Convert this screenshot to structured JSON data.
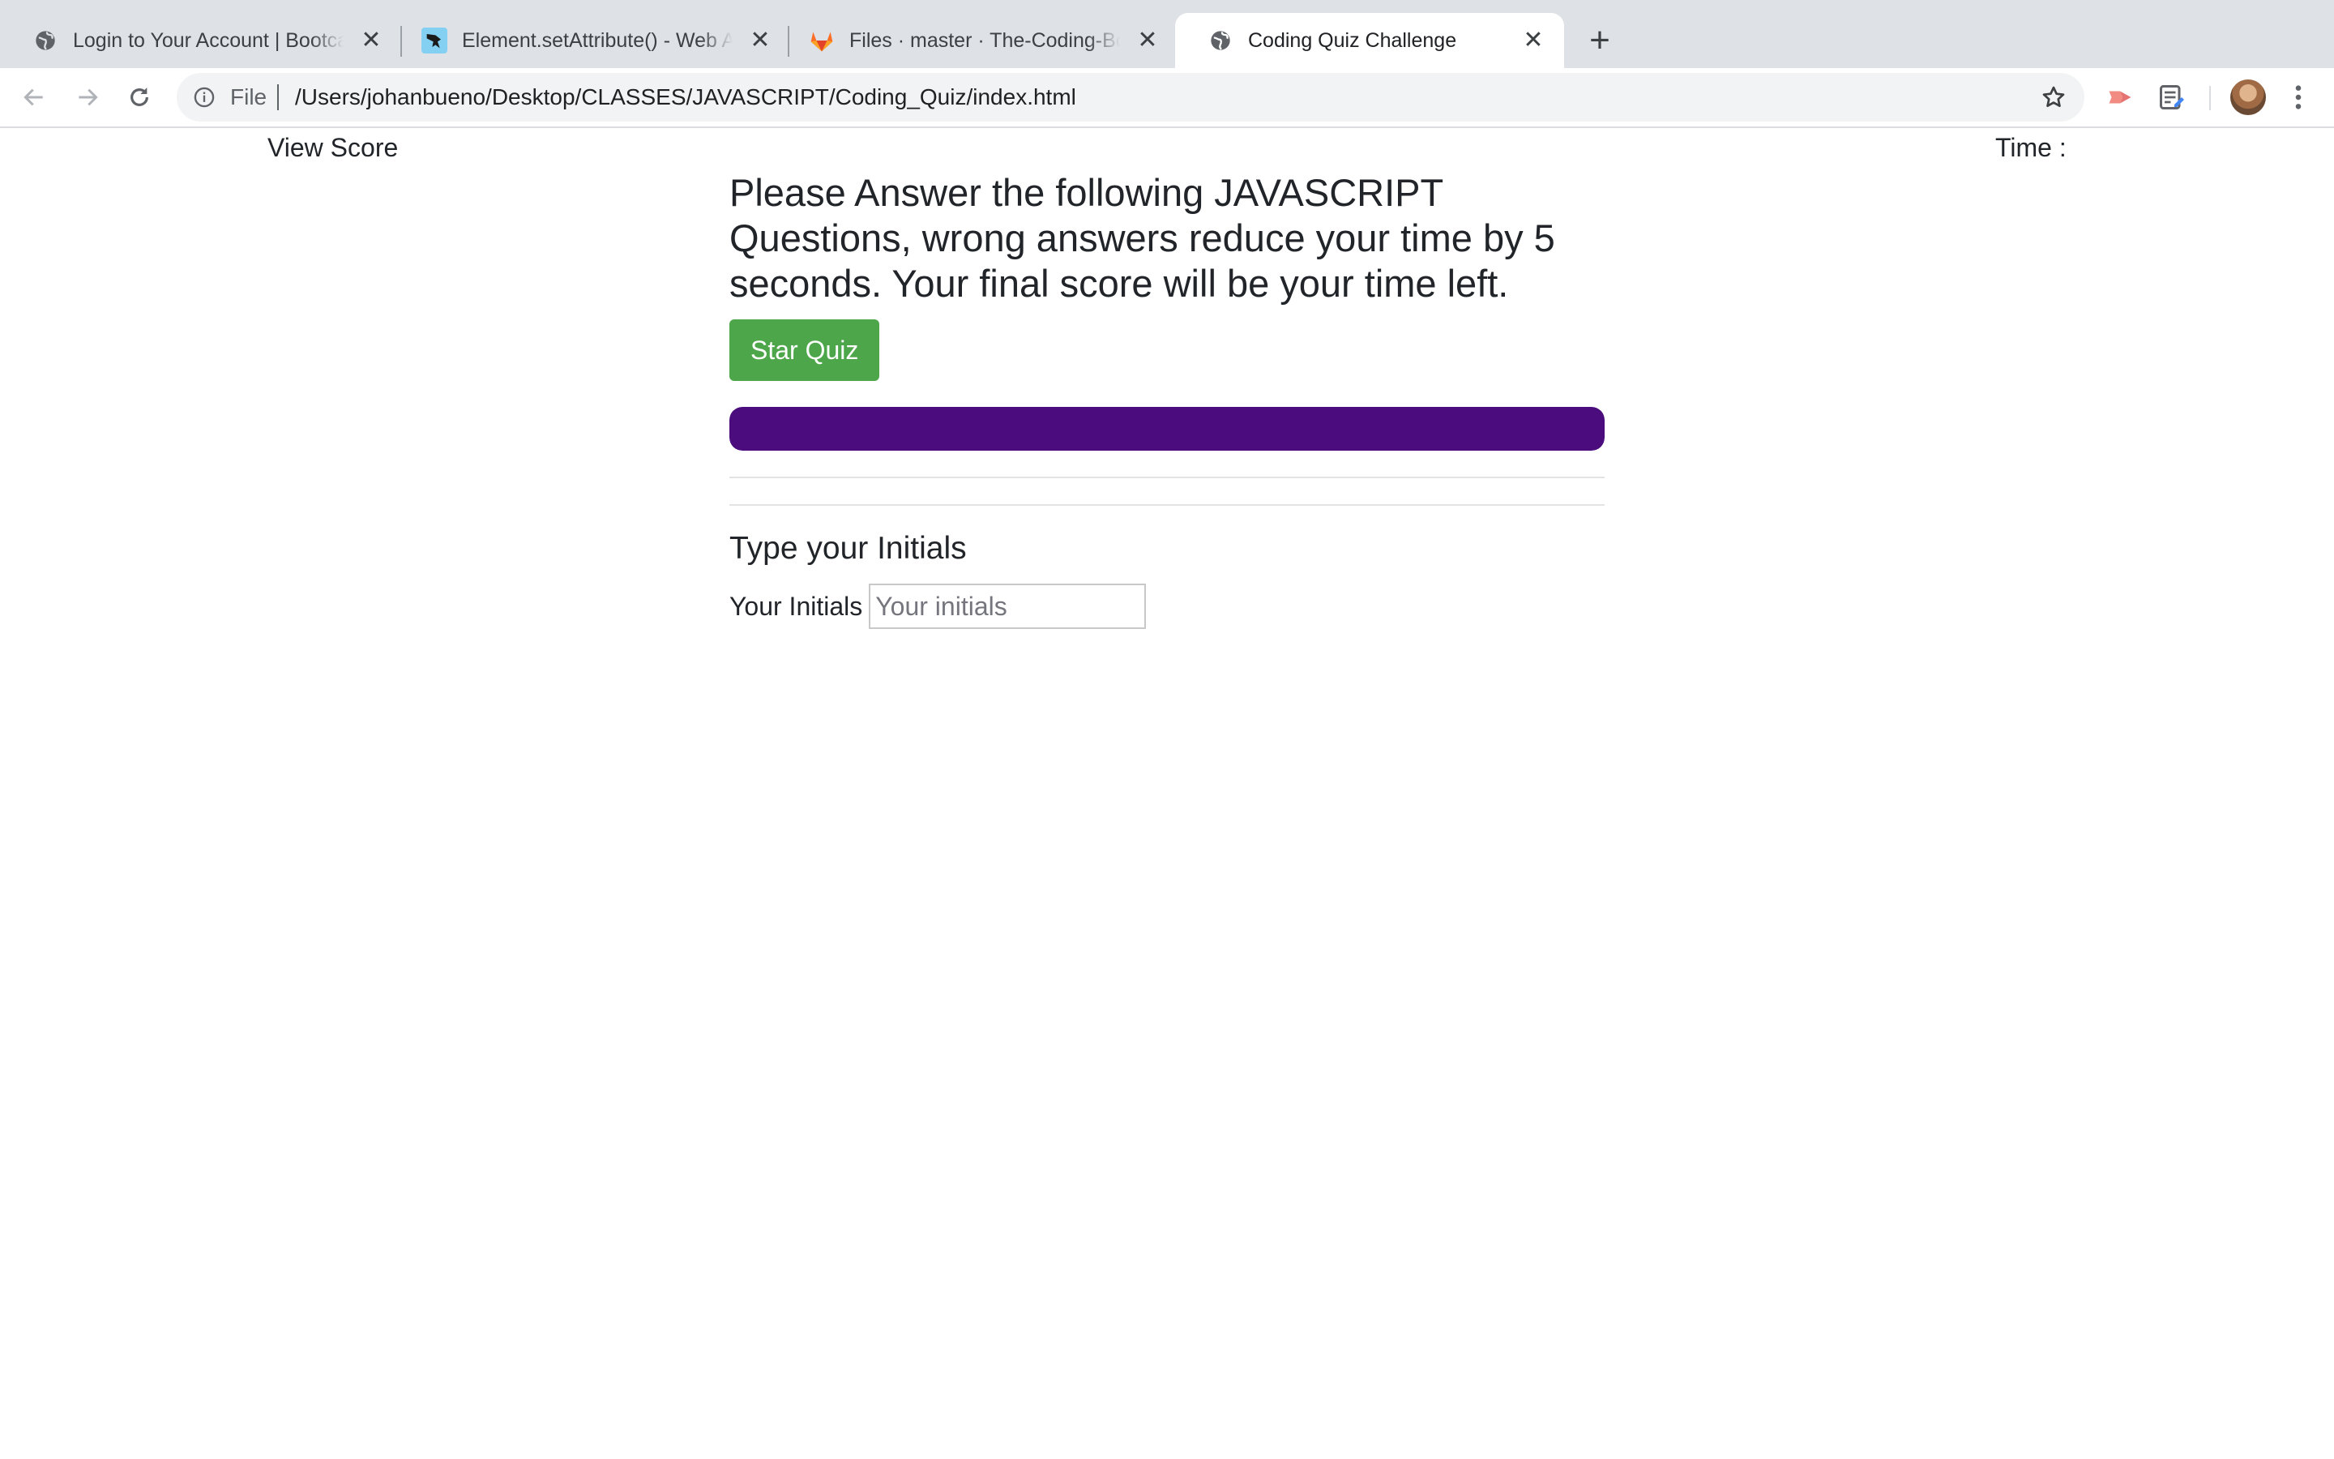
{
  "browser": {
    "tabs": [
      {
        "title": "Login to Your Account | Bootcamp Spot",
        "favicon": "globe-icon",
        "active": false
      },
      {
        "title": "Element.setAttribute() - Web APIs | MDN",
        "favicon": "mdn-dino-icon",
        "active": false
      },
      {
        "title": "Files · master · The-Coding-Bootcamp",
        "favicon": "gitlab-icon",
        "active": false
      },
      {
        "title": "Coding Quiz Challenge",
        "favicon": "globe-icon",
        "active": true
      }
    ],
    "new_tab_label": "+",
    "close_label": "✕",
    "address": {
      "scheme_label": "File",
      "url": "/Users/johanbueno/Desktop/CLASSES/JAVASCRIPT/Coding_Quiz/index.html"
    }
  },
  "page": {
    "view_score_label": "View Score",
    "timer_label": "Time :",
    "intro_heading": "Please Answer the following JAVASCRIPT Questions, wrong answers reduce your time by 5 seconds. Your final score will be your time left.",
    "start_button_label": "Star Quiz",
    "progress_fraction": 1.0,
    "progress_color": "#4b0d7d",
    "start_button_color": "#4da74a",
    "initials_heading": "Type your Initials",
    "initials_label": "Your Initials",
    "initials_value": "",
    "initials_placeholder": "Your initials"
  }
}
